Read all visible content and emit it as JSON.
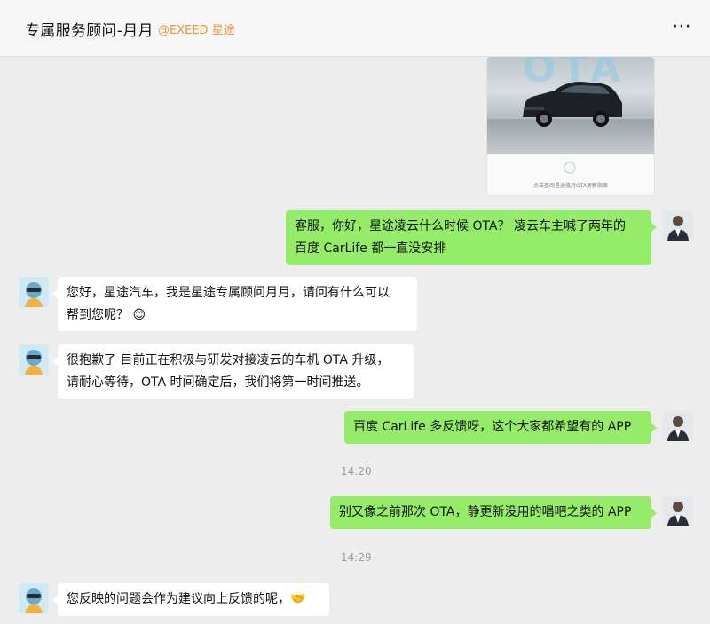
{
  "header": {
    "title": "专属服务顾问-月月",
    "tag": "@EXEED 星途",
    "more_icon": "⋯"
  },
  "image_message": {
    "watermark": "OTA",
    "caption": "点击查阅星途揽月OTA更新指南"
  },
  "messages": [
    {
      "side": "me",
      "lines": [
        "客服，你好，星途凌云什么时候 OTA？ 凌云车主喊了两年的",
        "百度 CarLife 都一直没安排"
      ]
    },
    {
      "side": "bot",
      "lines": [
        "您好，星途汽车，我是星途专属顾问月月，请问有什么可以",
        "帮到您呢？"
      ],
      "emoji": "😊"
    },
    {
      "side": "bot",
      "lines": [
        "很抱歉了 目前正在积极与研发对接凌云的车机 OTA 升级，",
        "请耐心等待，OTA 时间确定后，我们将第一时间推送。"
      ]
    },
    {
      "side": "me",
      "lines": [
        "百度 CarLife  多反馈呀，这个大家都希望有的 APP"
      ]
    },
    {
      "side": "me",
      "lines": [
        "别又像之前那次 OTA，静更新没用的唱吧之类的 APP"
      ]
    },
    {
      "side": "bot",
      "lines": [
        "您反映的问题会作为建议向上反馈的呢，"
      ],
      "emoji": "🤝"
    }
  ],
  "timestamps": [
    "14:20",
    "14:29"
  ],
  "colors": {
    "accent_tag": "#e8953a",
    "my_bubble": "#95ec69",
    "bot_bubble": "#ffffff",
    "background": "#ededed"
  }
}
